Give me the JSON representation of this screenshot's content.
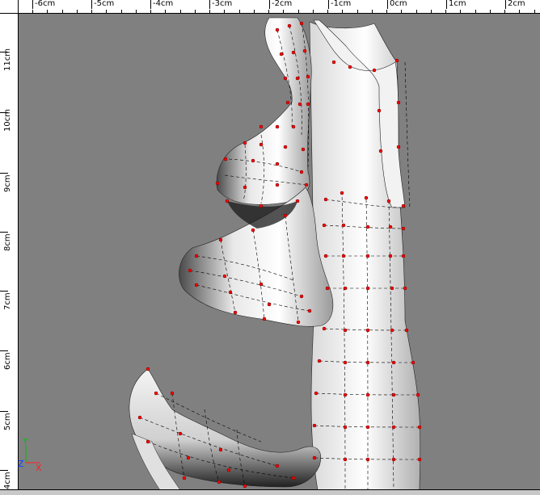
{
  "ruler_top": {
    "labels": [
      "-6cm",
      "-5cm",
      "-4cm",
      "-3cm",
      "-2cm",
      "-1cm",
      "0cm",
      "1cm",
      "2cm"
    ]
  },
  "ruler_left": {
    "labels": [
      "11cm",
      "10cm",
      "9cm",
      "8cm",
      "7cm",
      "6cm",
      "5cm",
      "4cm"
    ]
  },
  "gizmo": {
    "y_label": "Y",
    "z_label": "Z",
    "x_label": "X",
    "y_color": "#00c000",
    "z_color": "#1040ff",
    "x_color": "#ff2020"
  },
  "colors": {
    "background": "#808080",
    "control_point": "#ff0000",
    "ruler": "#ffffff"
  }
}
